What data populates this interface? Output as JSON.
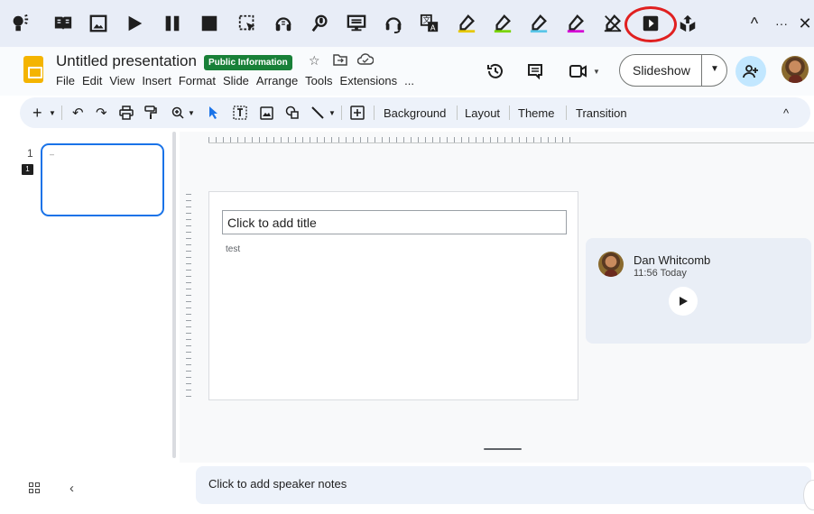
{
  "extension_bar": {
    "icons": [
      "bulb-person-icon",
      "book-icon",
      "image-icon",
      "play-icon",
      "pause-icon",
      "stop-icon",
      "select-area-icon",
      "headphones-speech-icon",
      "voice-search-icon",
      "monitor-icon",
      "headset-icon",
      "translate-icon",
      "highlighter-yellow-icon",
      "highlighter-green-icon",
      "highlighter-blue-icon",
      "highlighter-pink-icon",
      "eraser-icon",
      "play-box-icon",
      "export-icon"
    ],
    "right_controls": {
      "collapse": "^",
      "more": "···",
      "close": "✕"
    },
    "highlight_circle_color": "#e02020"
  },
  "header": {
    "title": "Untitled presentation",
    "badge": "Public Information",
    "badge_color": "#188038",
    "menu": [
      "File",
      "Edit",
      "View",
      "Insert",
      "Format",
      "Slide",
      "Arrange",
      "Tools",
      "Extensions",
      "..."
    ],
    "slideshow_label": "Slideshow"
  },
  "toolbar": {
    "background": "Background",
    "layout": "Layout",
    "theme": "Theme",
    "transition": "Transition"
  },
  "filmstrip": {
    "slide_number": "1",
    "comment_count": "1",
    "thumb_text": "–"
  },
  "slide": {
    "title_placeholder": "Click to add title",
    "body": "test"
  },
  "comment": {
    "author": "Dan Whitcomb",
    "time": "11:56 Today"
  },
  "notes": {
    "placeholder": "Click to add speaker notes"
  },
  "colors": {
    "accent": "#1a73e8",
    "toolbar_bg": "#edf2fa",
    "share_bg": "#c2e7ff",
    "slides_logo": "#f4b400"
  }
}
